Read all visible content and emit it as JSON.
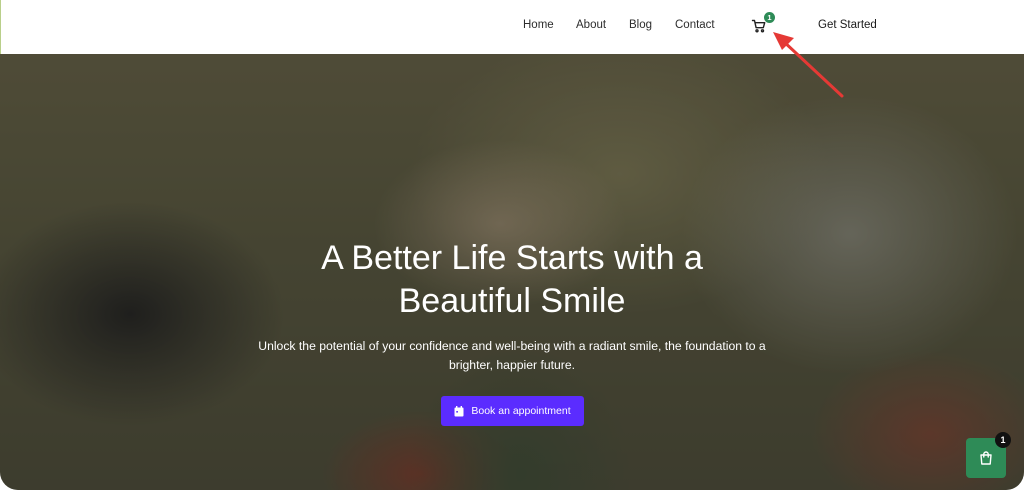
{
  "nav": {
    "items": [
      {
        "label": "Home"
      },
      {
        "label": "About"
      },
      {
        "label": "Blog"
      },
      {
        "label": "Contact"
      }
    ],
    "cart_count": "1",
    "get_started_label": "Get Started"
  },
  "hero": {
    "title_line1": "A Better Life Starts with a",
    "title_line2": "Beautiful Smile",
    "subtitle_line1": "Unlock the potential of your confidence and well-being with a radiant smile, the foundation to a",
    "subtitle_line2": "brighter, happier future.",
    "cta_label": "Book an appointment"
  },
  "floating_cart": {
    "count": "1"
  },
  "colors": {
    "cta": "#5b2cff",
    "cart_badge": "#2e8b57",
    "annotation_arrow": "#e53935"
  }
}
